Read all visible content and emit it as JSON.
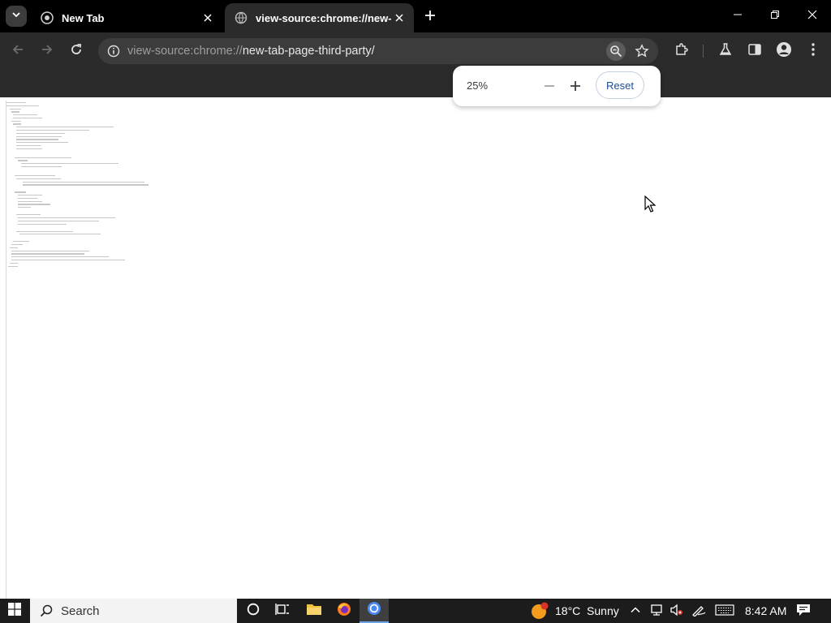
{
  "tabs": [
    {
      "title": "New Tab",
      "icon": "chrome-new-tab-icon"
    },
    {
      "title": "view-source:chrome://new-tab-page-third-party/",
      "icon": "globe-icon"
    }
  ],
  "omnibox": {
    "url_prefix": "view-source:chrome://",
    "url_host": "new-tab-page-third-party/"
  },
  "zoom": {
    "level": "25%",
    "reset_label": "Reset"
  },
  "taskbar": {
    "search_label": "Search",
    "weather": "18°C  Sunny",
    "time": "8:42 AM"
  },
  "colors": {
    "tabstrip": "#000000",
    "toolbar": "#2b2b2b",
    "accent": "#1a4f9c"
  }
}
